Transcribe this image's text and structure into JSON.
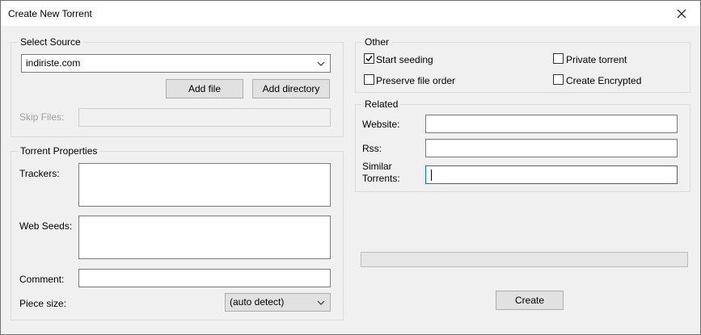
{
  "window": {
    "title": "Create New Torrent",
    "close_icon": "close-icon"
  },
  "select_source": {
    "legend": "Select Source",
    "source_value": "indiriste.com",
    "add_file_label": "Add file",
    "add_directory_label": "Add directory",
    "skip_files_label": "Skip Files:",
    "skip_files_value": ""
  },
  "torrent_properties": {
    "legend": "Torrent Properties",
    "trackers_label": "Trackers:",
    "trackers_value": "",
    "web_seeds_label": "Web Seeds:",
    "web_seeds_value": "",
    "comment_label": "Comment:",
    "comment_value": "",
    "piece_size_label": "Piece size:",
    "piece_size_value": "(auto detect)"
  },
  "other": {
    "legend": "Other",
    "start_seeding": {
      "label": "Start seeding",
      "checked": true
    },
    "private_torrent": {
      "label": "Private torrent",
      "checked": false
    },
    "preserve_file_order": {
      "label": "Preserve file order",
      "checked": false
    },
    "create_encrypted": {
      "label": "Create Encrypted",
      "checked": false
    }
  },
  "related": {
    "legend": "Related",
    "website_label": "Website:",
    "website_value": "",
    "rss_label": "Rss:",
    "rss_value": "",
    "similar_label_line1": "Similar",
    "similar_label_line2": "Torrents:",
    "similar_value": ""
  },
  "progress": {
    "value": 0
  },
  "create_button_label": "Create",
  "colors": {
    "focus_border": "#0078d7",
    "progress_fill": "#06b025"
  }
}
